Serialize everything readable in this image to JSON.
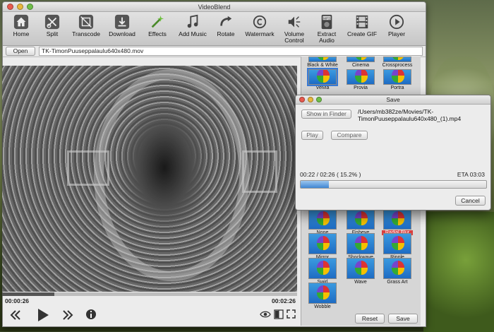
{
  "window": {
    "title": "VideoBlend"
  },
  "toolbar": [
    {
      "label": "Home",
      "icon": "home-icon"
    },
    {
      "label": "Split",
      "icon": "split-icon"
    },
    {
      "label": "Transcode",
      "icon": "transcode-icon"
    },
    {
      "label": "Download",
      "icon": "download-icon"
    },
    {
      "label": "Effects",
      "icon": "effects-wand-icon"
    },
    {
      "label": "Add Music",
      "icon": "music-note-icon"
    },
    {
      "label": "Rotate",
      "icon": "rotate-icon"
    },
    {
      "label": "Watermark",
      "icon": "copyright-icon"
    },
    {
      "label": "Volume\nControl",
      "icon": "speaker-icon"
    },
    {
      "label": "Extract\nAudio",
      "icon": "mp3-icon"
    },
    {
      "label": "Create GIF",
      "icon": "film-icon"
    },
    {
      "label": "Player",
      "icon": "play-circle-icon"
    }
  ],
  "openbar": {
    "open_label": "Open",
    "file_name": "TK-TimonPuuseppalaulu640x480.mov"
  },
  "player": {
    "current_time": "00:00:26",
    "end_time": "00:02:26",
    "seek_fraction": 0.178
  },
  "effects": {
    "top_row": [
      "Black & White",
      "Cinema",
      "Crossprocess"
    ],
    "second_row": [
      "Velvia",
      "Provia",
      "Portra"
    ],
    "rows": [
      [
        "None",
        "Fisheye",
        "Radial Blur"
      ],
      [
        "Mirror",
        "Shockwave",
        "Ripple"
      ],
      [
        "Swirl",
        "Wave",
        "Grass Art"
      ],
      [
        "Wobble"
      ]
    ],
    "active": "Radial Blur",
    "reset_label": "Reset",
    "save_label": "Save"
  },
  "dialog": {
    "title": "Save",
    "show_in_finder_label": "Show in Finder",
    "output_path": "/Users/mb382ze/Movies/TK-TimonPuuseppalaulu640x480_(1).mp4",
    "play_label": "Play",
    "compare_label": "Compare",
    "progress_text": "00:22 / 02:26 ( 15.2% )",
    "eta": "ETA 03:03",
    "progress_fraction": 0.152,
    "cancel_label": "Cancel"
  },
  "colors": {
    "active_effect": "#d94040",
    "progress": "#3f86d3",
    "selection": "#3a7bd5"
  }
}
